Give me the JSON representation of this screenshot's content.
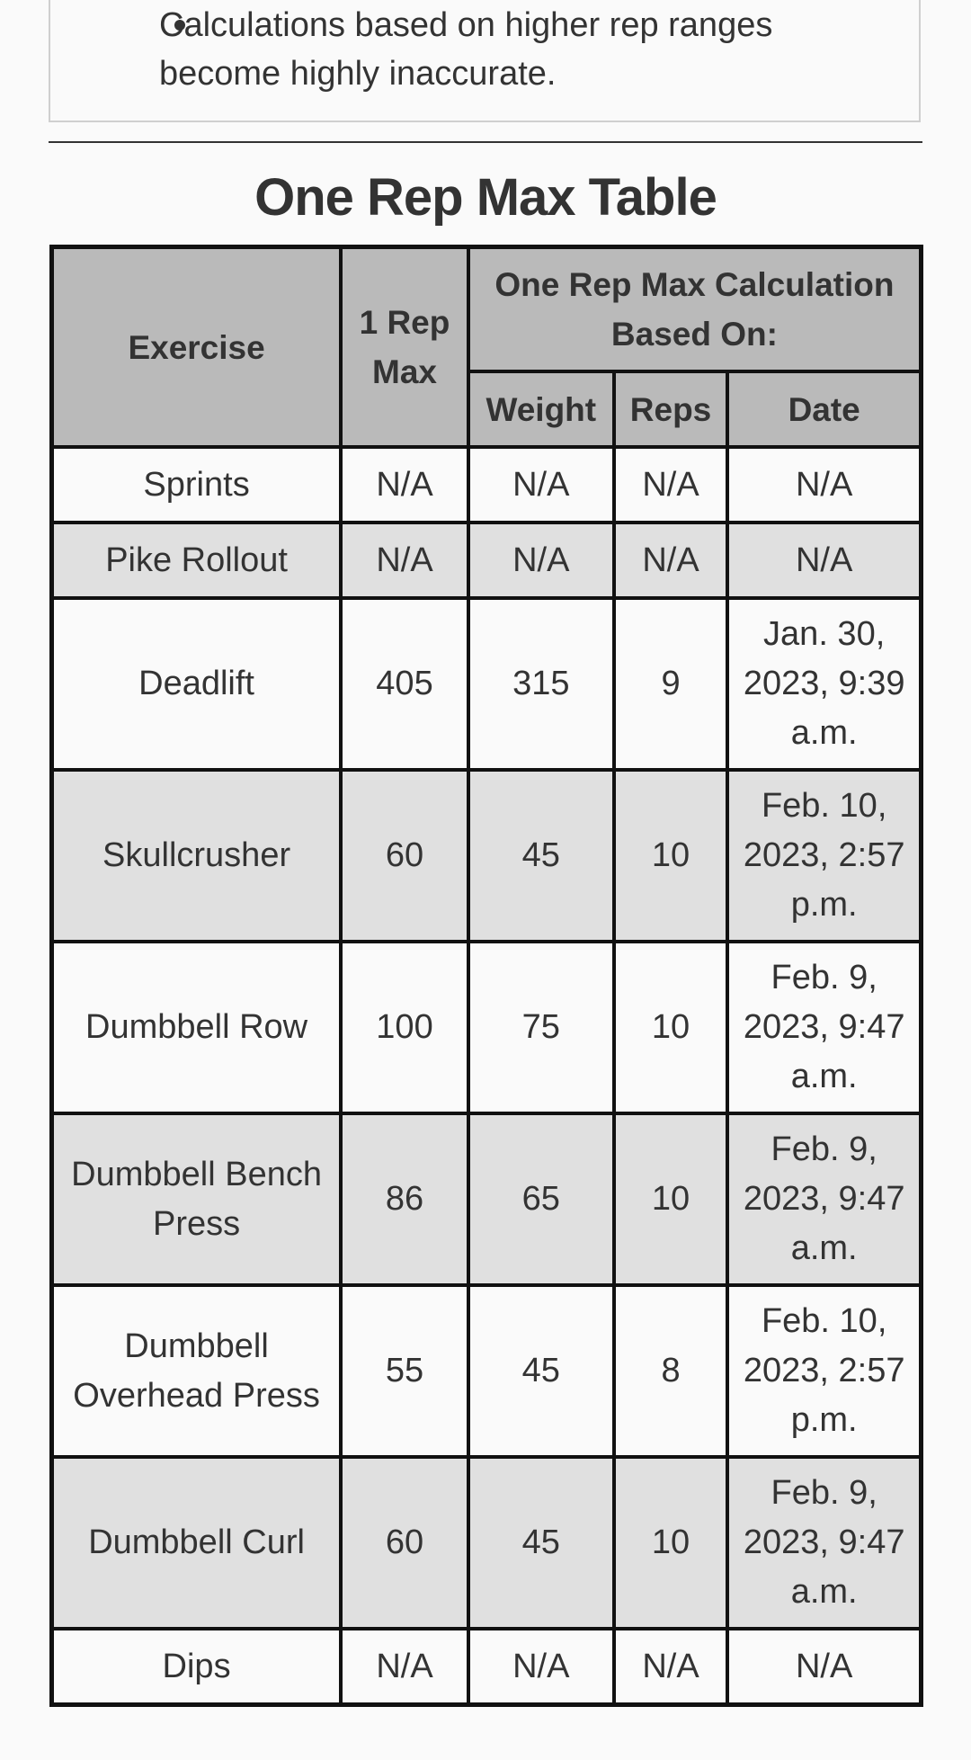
{
  "notes": {
    "items": [
      "Calculations based on higher rep ranges become highly inaccurate."
    ]
  },
  "section_title": "One Rep Max Table",
  "table": {
    "headers": {
      "exercise": "Exercise",
      "one_rep_max": "1 Rep Max",
      "group": "One Rep Max Calculation Based On:",
      "weight": "Weight",
      "reps": "Reps",
      "date": "Date"
    },
    "rows": [
      {
        "exercise": "Sprints",
        "max": "N/A",
        "weight": "N/A",
        "reps": "N/A",
        "date": "N/A"
      },
      {
        "exercise": "Pike Rollout",
        "max": "N/A",
        "weight": "N/A",
        "reps": "N/A",
        "date": "N/A"
      },
      {
        "exercise": "Deadlift",
        "max": "405",
        "weight": "315",
        "reps": "9",
        "date": "Jan. 30, 2023, 9:39 a.m."
      },
      {
        "exercise": "Skullcrusher",
        "max": "60",
        "weight": "45",
        "reps": "10",
        "date": "Feb. 10, 2023, 2:57 p.m."
      },
      {
        "exercise": "Dumbbell Row",
        "max": "100",
        "weight": "75",
        "reps": "10",
        "date": "Feb. 9, 2023, 9:47 a.m."
      },
      {
        "exercise": "Dumbbell Bench Press",
        "max": "86",
        "weight": "65",
        "reps": "10",
        "date": "Feb. 9, 2023, 9:47 a.m."
      },
      {
        "exercise": "Dumbbell Overhead Press",
        "max": "55",
        "weight": "45",
        "reps": "8",
        "date": "Feb. 10, 2023, 2:57 p.m."
      },
      {
        "exercise": "Dumbbell Curl",
        "max": "60",
        "weight": "45",
        "reps": "10",
        "date": "Feb. 9, 2023, 9:47 a.m."
      },
      {
        "exercise": "Dips",
        "max": "N/A",
        "weight": "N/A",
        "reps": "N/A",
        "date": "N/A"
      }
    ]
  }
}
